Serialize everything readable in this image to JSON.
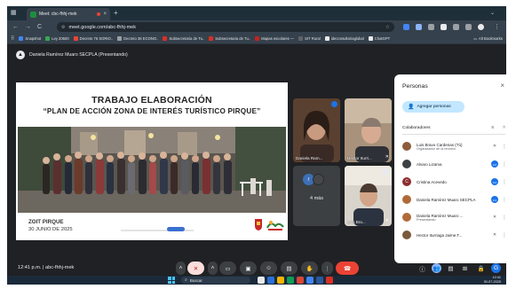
{
  "browser": {
    "tab_title": "Meet: cbc-fhhj-mek",
    "tab_close": "×",
    "new_tab": "+",
    "url": "meet.google.com/abc-fhhj-mek",
    "back": "←",
    "forward": "→",
    "reload": "C",
    "bookmarks": [
      {
        "label": "Snapshot",
        "color": "#4285f4"
      },
      {
        "label": "Ley 20500",
        "color": "#34a853"
      },
      {
        "label": "Decreto 75 SORIO..",
        "color": "#ea4335"
      },
      {
        "label": "Decreto 36 ECONO..",
        "color": "#9aa0a6"
      },
      {
        "label": "Subsecretaria de Tu..",
        "color": "#d93025"
      },
      {
        "label": "Subsecretaria de Tu..",
        "color": "#d93025"
      },
      {
        "label": "Mapas escolares —",
        "color": "#c5221f"
      },
      {
        "label": "SIT Rural",
        "color": "#5f6368"
      },
      {
        "label": "ideconsultoriaglobal",
        "color": "#e8eaed"
      },
      {
        "label": "ChatGPT",
        "color": "#e8eaed"
      }
    ],
    "bookmarks_folder": "Alt Bookmarks"
  },
  "meet": {
    "presenting_label": "Daniela Ramírez Muaro SECPLA (Presentando)",
    "slide": {
      "title": "TRABAJO ELABORACIÓN",
      "subtitle": "“PLAN DE ACCIÓN ZONA DE INTERÉS TURÍSTICO PIRQUE”",
      "location": "ZOIT PIRQUE",
      "date": "30 JUNIO DE 2025"
    },
    "tiles": [
      {
        "name": "Daniela Ram..."
      },
      {
        "name": "Hector Iturri..."
      },
      {
        "name": "Luis Bra..."
      }
    ],
    "more_count": "4 más",
    "more_initial": "r",
    "clock": "12:41 p.m.",
    "separator": "|",
    "meeting_code": "abc-fhhj-mek",
    "icons": {
      "mic": "mic-off-icon",
      "camera": "camera-icon",
      "present": "present-icon"
    }
  },
  "people_panel": {
    "title": "Personas",
    "close": "×",
    "add_button": "Agregar personas",
    "section": "Colaboradores",
    "count": "8",
    "people": [
      {
        "name": "Luis Bravo Cardenas (Tú)",
        "role": "Organizador de la reunión",
        "color": "#8e5c3b"
      },
      {
        "name": "Alvaro Lizama",
        "role": "",
        "color": "#3c4043"
      },
      {
        "name": "Cristina Acevedo",
        "role": "",
        "color": "#8d2e2e"
      },
      {
        "name": "Daniela Ramírez Muaro SECPLA",
        "role": "",
        "color": "#b06a3a"
      },
      {
        "name": "Daniela Ramírez Muaro ...",
        "role": "Presentando",
        "color": "#b06a3a"
      },
      {
        "name": "Hector Iturriaga Jaime T...",
        "role": "",
        "color": "#7a5a3a"
      }
    ]
  },
  "taskbar": {
    "search": "Buscar",
    "time": "12:41",
    "date": "30-07-2025"
  }
}
